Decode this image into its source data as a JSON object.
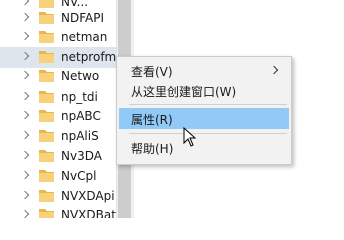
{
  "tree": {
    "items": [
      {
        "label": "NV..."
      },
      {
        "label": "NDFAPI"
      },
      {
        "label": "netman"
      },
      {
        "label": "netprofm"
      },
      {
        "label": "Netwo"
      },
      {
        "label": "np_tdi"
      },
      {
        "label": "npABC"
      },
      {
        "label": "npAliS"
      },
      {
        "label": "Nv3DA"
      },
      {
        "label": "NvCpl"
      },
      {
        "label": "NVXDApi"
      },
      {
        "label": "NVXDBat"
      }
    ]
  },
  "context_menu": {
    "view": "查看(V)",
    "create_window": "从这里创建窗口(W)",
    "properties": "属性(R)",
    "help": "帮助(H)"
  },
  "colors": {
    "menu_bg": "#f2f2f2",
    "selected_bg": "#91c9f7",
    "hover_row": "#dfe5ec"
  }
}
